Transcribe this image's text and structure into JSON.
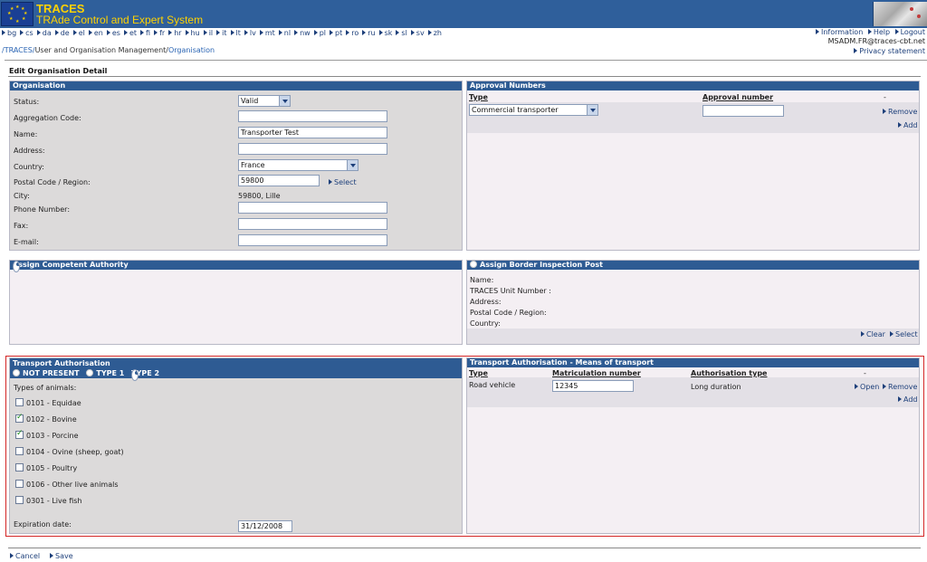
{
  "header": {
    "brand_title": "TRACES",
    "brand_subtitle": "TRAde Control and Expert System",
    "languages": [
      "bg",
      "cs",
      "da",
      "de",
      "el",
      "en",
      "es",
      "et",
      "fi",
      "fr",
      "hr",
      "hu",
      "il",
      "it",
      "lt",
      "lv",
      "mt",
      "nl",
      "nw",
      "pl",
      "pt",
      "ro",
      "ru",
      "sk",
      "sl",
      "sv",
      "zh"
    ],
    "links": {
      "information": "Information",
      "help": "Help",
      "logout": "Logout"
    },
    "user_email": "MSADM.FR@traces-cbt.net",
    "privacy": "Privacy statement"
  },
  "breadcrumb": {
    "root": "/TRACES/",
    "mid": "User and Organisation Management/",
    "current": "Organisation"
  },
  "page_title": "Edit Organisation Detail",
  "organisation": {
    "heading": "Organisation",
    "status_label": "Status:",
    "status_value": "Valid",
    "aggregation_label": "Aggregation Code:",
    "aggregation_value": "",
    "name_label": "Name:",
    "name_value": "Transporter Test",
    "address_label": "Address:",
    "address_value": "",
    "country_label": "Country:",
    "country_value": "France",
    "postal_label": "Postal Code / Region:",
    "postal_value": "59800",
    "select_link": "Select",
    "city_label": "City:",
    "city_value": "59800, Lille",
    "phone_label": "Phone Number:",
    "phone_value": "",
    "fax_label": "Fax:",
    "fax_value": "",
    "email_label": "E-mail:",
    "email_value": ""
  },
  "approval": {
    "heading": "Approval Numbers",
    "col_type": "Type",
    "col_number": "Approval number",
    "col_extra": "-",
    "row_type": "Commercial transporter",
    "row_number": "",
    "remove": "Remove",
    "add": "Add"
  },
  "competent_authority": {
    "heading": "Assign Competent Authority"
  },
  "border_post": {
    "heading": "Assign Border Inspection Post",
    "name_label": "Name:",
    "unit_label": "TRACES Unit Number :",
    "address_label": "Address:",
    "postal_label": "Postal Code / Region:",
    "country_label": "Country:",
    "clear": "Clear",
    "select": "Select"
  },
  "transport_auth": {
    "heading": "Transport Authorisation",
    "opt_not_present": "NOT PRESENT",
    "opt_type1": "TYPE 1",
    "opt_type2": "TYPE 2",
    "types_label": "Types of animals:",
    "animals": [
      {
        "label": "0101 - Equidae",
        "checked": false
      },
      {
        "label": "0102 - Bovine",
        "checked": true
      },
      {
        "label": "0103 - Porcine",
        "checked": true
      },
      {
        "label": "0104 - Ovine (sheep, goat)",
        "checked": false
      },
      {
        "label": "0105 - Poultry",
        "checked": false
      },
      {
        "label": "0106 - Other live animals",
        "checked": false
      },
      {
        "label": "0301 - Live fish",
        "checked": false
      }
    ],
    "expiration_label": "Expiration date:",
    "expiration_value": "31/12/2008"
  },
  "means": {
    "heading": "Transport Authorisation - Means of transport",
    "col_type": "Type",
    "col_matric": "Matriculation number",
    "col_auth": "Authorisation type",
    "col_extra": "-",
    "row_type": "Road vehicle",
    "row_matric": "12345",
    "row_auth": "Long duration",
    "open": "Open",
    "remove": "Remove",
    "add": "Add"
  },
  "footer": {
    "cancel": "Cancel",
    "save": "Save"
  },
  "colors": {
    "banner": "#2f5f9b",
    "panel_header": "#2e5b93",
    "brand": "#ffd200",
    "highlight": "#d32525"
  }
}
